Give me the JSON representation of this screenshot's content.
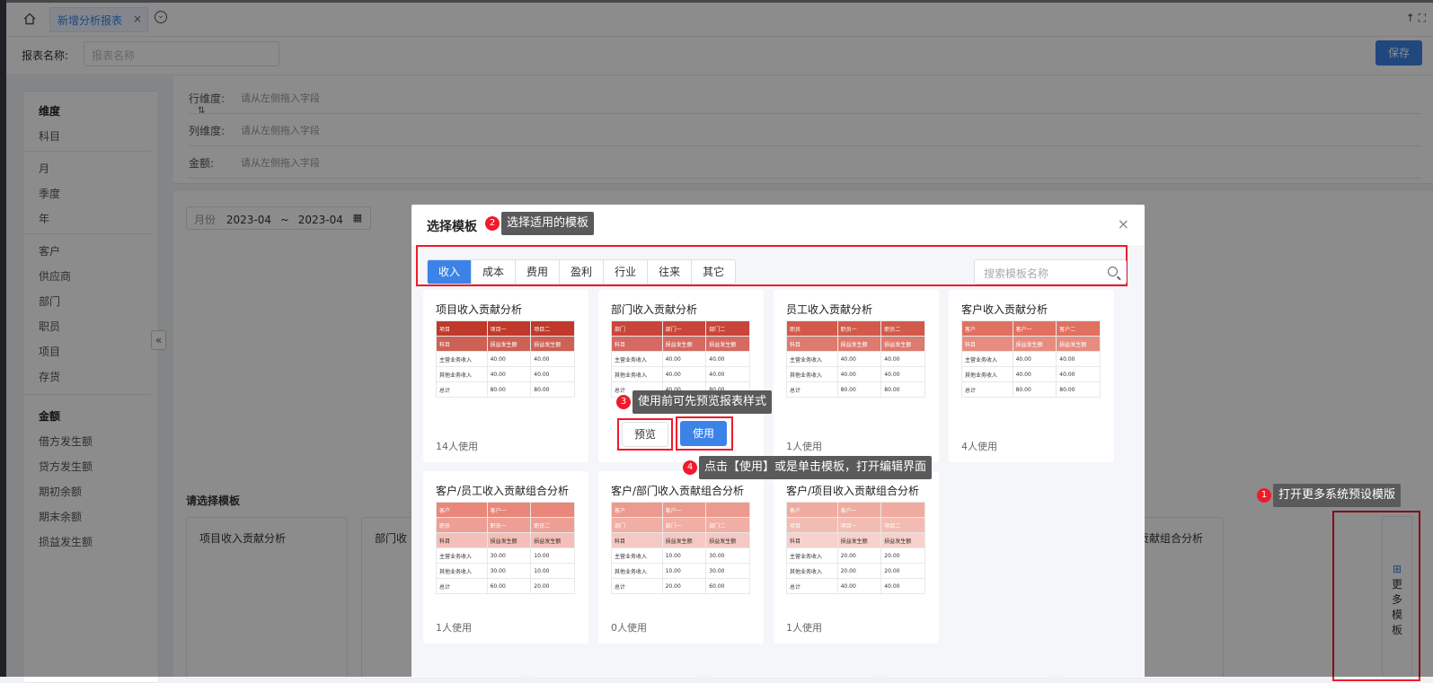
{
  "tabs": {
    "active_label": "新增分析报表",
    "close": "×"
  },
  "topright": "↑ ⛶",
  "report": {
    "name_label": "报表名称:",
    "name_placeholder": "报表名称",
    "save": "保存"
  },
  "sidebar": {
    "dim_head": "维度",
    "dims1": [
      "科目"
    ],
    "dims2": [
      "月",
      "季度",
      "年"
    ],
    "dims3": [
      "客户",
      "供应商",
      "部门",
      "职员",
      "项目",
      "存货"
    ],
    "amt_head": "金额",
    "amounts": [
      "借方发生额",
      "贷方发生额",
      "期初余额",
      "期末余额",
      "损益发生额"
    ],
    "collapse": "«"
  },
  "dims": {
    "row_label": "行维度:",
    "col_label": "列维度:",
    "amt_label": "金额:",
    "placeholder": "请从左侧拖入字段",
    "swap": "⇅"
  },
  "date": {
    "label": "月份",
    "start": "2023-04",
    "sep": "~",
    "end": "2023-04"
  },
  "picker": {
    "title": "请选择模板",
    "bg_titles": [
      "项目收入贡献分析",
      "部门收",
      "收入贡献组合分析"
    ]
  },
  "more": {
    "label": "更多模板",
    "hint": "1"
  },
  "dialog": {
    "title": "选择模板",
    "close": "×",
    "tabs": [
      "收入",
      "成本",
      "费用",
      "盈利",
      "行业",
      "往来",
      "其它"
    ],
    "search_placeholder": "搜索模板名称",
    "preview": "预览",
    "use": "使用",
    "cards": [
      {
        "title": "项目收入贡献分析",
        "uses": "14人使用",
        "header": [
          "项目",
          "项目一",
          "项目二"
        ],
        "sub": [
          "科目",
          "损益发生额",
          "损益发生额"
        ],
        "rows": [
          [
            "主营业务收入",
            "40.00",
            "40.00"
          ],
          [
            "其他业务收入",
            "40.00",
            "40.00"
          ],
          [
            "总计",
            "80.00",
            "80.00"
          ]
        ],
        "color": "#c0392b"
      },
      {
        "title": "部门收入贡献分析",
        "uses": "",
        "header": [
          "部门",
          "部门一",
          "部门二"
        ],
        "sub": [
          "科目",
          "损益发生额",
          "损益发生额"
        ],
        "rows": [
          [
            "主营业务收入",
            "40.00",
            "40.00"
          ],
          [
            "其他业务收入",
            "40.00",
            "40.00"
          ],
          [
            "总计",
            "40.00",
            "80.00"
          ]
        ],
        "color": "#c9453a"
      },
      {
        "title": "员工收入贡献分析",
        "uses": "1人使用",
        "header": [
          "职员",
          "职员一",
          "职员二"
        ],
        "sub": [
          "科目",
          "损益发生额",
          "损益发生额"
        ],
        "rows": [
          [
            "主营业务收入",
            "40.00",
            "40.00"
          ],
          [
            "其他业务收入",
            "40.00",
            "40.00"
          ],
          [
            "总计",
            "80.00",
            "80.00"
          ]
        ],
        "color": "#d35a4a"
      },
      {
        "title": "客户收入贡献分析",
        "uses": "4人使用",
        "header": [
          "客户",
          "客户一",
          "客户二"
        ],
        "sub": [
          "科目",
          "损益发生额",
          "损益发生额"
        ],
        "rows": [
          [
            "主营业务收入",
            "40.00",
            "40.00"
          ],
          [
            "其他业务收入",
            "40.00",
            "40.00"
          ],
          [
            "总计",
            "80.00",
            "80.00"
          ]
        ],
        "color": "#e07060"
      },
      {
        "title": "客户/员工收入贡献组合分析",
        "uses": "1人使用",
        "header": [
          "客户",
          "客户一",
          ""
        ],
        "sub": [
          "职员",
          "职员一",
          "职员二"
        ],
        "sub2": [
          "科目",
          "损益发生额",
          "损益发生额"
        ],
        "rows": [
          [
            "主营业务收入",
            "30.00",
            "10.00"
          ],
          [
            "其他业务收入",
            "30.00",
            "10.00"
          ],
          [
            "总计",
            "60.00",
            "20.00"
          ]
        ],
        "color": "#e8877a"
      },
      {
        "title": "客户/部门收入贡献组合分析",
        "uses": "0人使用",
        "header": [
          "客户",
          "客户一",
          ""
        ],
        "sub": [
          "部门",
          "部门一",
          "部门二"
        ],
        "sub2": [
          "科目",
          "损益发生额",
          "损益发生额"
        ],
        "rows": [
          [
            "主营业务收入",
            "10.00",
            "30.00"
          ],
          [
            "其他业务收入",
            "10.00",
            "30.00"
          ],
          [
            "总计",
            "20.00",
            "60.00"
          ]
        ],
        "color": "#ec9a8e"
      },
      {
        "title": "客户/项目收入贡献组合分析",
        "uses": "1人使用",
        "header": [
          "客户",
          "客户一",
          ""
        ],
        "sub": [
          "项目",
          "项目一",
          "项目二"
        ],
        "sub2": [
          "科目",
          "损益发生额",
          "损益发生额"
        ],
        "rows": [
          [
            "主营业务收入",
            "20.00",
            "20.00"
          ],
          [
            "其他业务收入",
            "20.00",
            "20.00"
          ],
          [
            "总计",
            "40.00",
            "40.00"
          ]
        ],
        "color": "#f0aba0"
      }
    ]
  },
  "annotations": {
    "a1": {
      "num": "1",
      "text": "打开更多系统预设模版"
    },
    "a2": {
      "num": "2",
      "text": "选择适用的模板"
    },
    "a3": {
      "num": "3",
      "text": "使用前可先预览报表样式"
    },
    "a4": {
      "num": "4",
      "text": "点击【使用】或是单击模板，打开编辑界面"
    }
  },
  "colors": {
    "accent": "#3b83e7",
    "highlight": "#f01a2b"
  }
}
